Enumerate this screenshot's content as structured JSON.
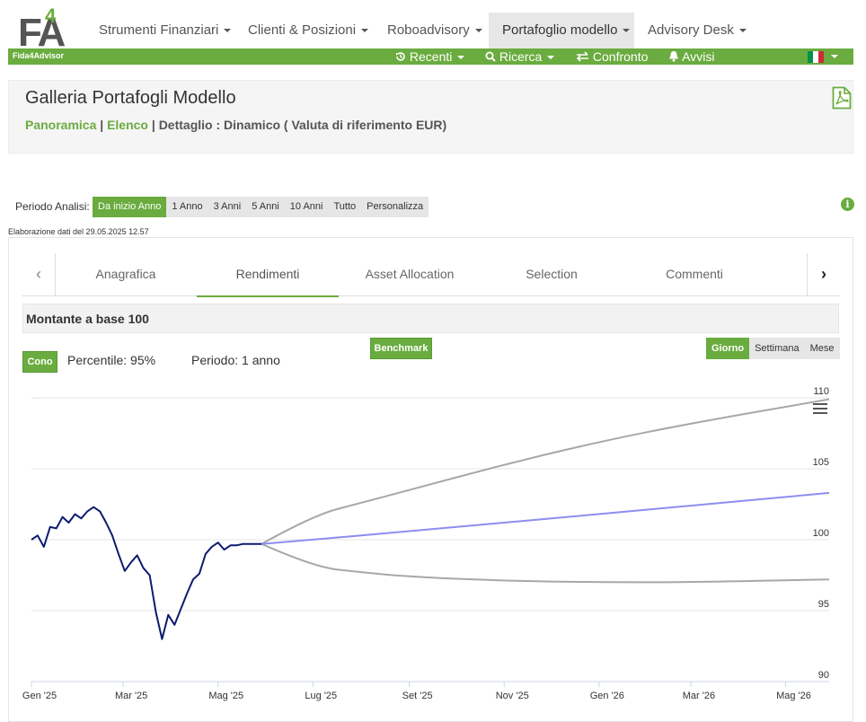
{
  "brand": {
    "logo_text": "F4A",
    "tagline": "Fida4Advisor"
  },
  "nav": {
    "items": [
      {
        "label": "Strumenti Finanziari"
      },
      {
        "label": "Clienti & Posizioni"
      },
      {
        "label": "Roboadvisory"
      },
      {
        "label": "Portafoglio modello"
      },
      {
        "label": "Advisory Desk"
      }
    ]
  },
  "subnav": {
    "recenti": "Recenti",
    "ricerca": "Ricerca",
    "confronto": "Confronto",
    "avvisi": "Avvisi"
  },
  "header": {
    "title": "Galleria Portafogli Modello",
    "crumb_panoramica": "Panoramica",
    "crumb_elenco": "Elenco",
    "crumb_detail": "Dettaglio : Dinamico ( Valuta di riferimento EUR)"
  },
  "period": {
    "label": "Periodo Analisi:",
    "options": [
      "Da inizio Anno",
      "1 Anno",
      "3 Anni",
      "5 Anni",
      "10 Anni",
      "Tutto",
      "Personalizza"
    ],
    "selected": "Da inizio Anno"
  },
  "elaboration": "Elaborazione dati del 29.05.2025 12.57",
  "tabs": [
    "Anagrafica",
    "Rendimenti",
    "Asset Allocation",
    "Selection",
    "Commenti"
  ],
  "active_tab": "Rendimenti",
  "section_title": "Montante a base 100",
  "controls": {
    "cono": "Cono",
    "percentile_label": "Percentile:",
    "percentile_value": "95%",
    "periodo_label": "Periodo:",
    "periodo_value": "1 anno",
    "benchmark": "Benchmark",
    "granularity": [
      "Giorno",
      "Settimana",
      "Mese"
    ],
    "granularity_selected": "Giorno"
  },
  "colors": {
    "brand_green": "#6aac3f",
    "historic_line": "#0d1b6e",
    "median_line": "#8d8df0",
    "cone_line": "#a8a8a8"
  },
  "chart_data": {
    "type": "line",
    "title": "",
    "ylim": [
      90,
      110
    ],
    "yticks": [
      90,
      95,
      100,
      105,
      110
    ],
    "x_ticks": [
      "Gen '25",
      "Mar '25",
      "Mag '25",
      "Lug '25",
      "Set '25",
      "Nov '25",
      "Gen '26",
      "Mar '26",
      "Mag '26"
    ],
    "series": [
      {
        "role": "historic",
        "x": [
          "2025-01-01",
          "2025-01-05",
          "2025-01-09",
          "2025-01-13",
          "2025-01-17",
          "2025-01-21",
          "2025-01-25",
          "2025-01-29",
          "2025-02-02",
          "2025-02-06",
          "2025-02-10",
          "2025-02-14",
          "2025-02-18",
          "2025-02-22",
          "2025-02-26",
          "2025-03-02",
          "2025-03-06",
          "2025-03-10",
          "2025-03-14",
          "2025-03-18",
          "2025-03-22",
          "2025-03-26",
          "2025-03-30",
          "2025-04-03",
          "2025-04-07",
          "2025-04-11",
          "2025-04-15",
          "2025-04-19",
          "2025-04-23",
          "2025-04-27",
          "2025-05-01",
          "2025-05-05",
          "2025-05-09",
          "2025-05-13",
          "2025-05-17",
          "2025-05-21",
          "2025-05-25",
          "2025-05-29"
        ],
        "values": [
          100.0,
          100.3,
          99.5,
          100.9,
          100.8,
          101.6,
          101.2,
          101.8,
          101.5,
          102.0,
          102.3,
          102.0,
          101.2,
          100.3,
          99.0,
          97.8,
          98.4,
          98.9,
          98.0,
          97.5,
          94.9,
          93.0,
          94.7,
          94.0,
          95.1,
          96.2,
          97.2,
          97.6,
          99.0,
          99.5,
          99.8,
          99.3,
          99.6,
          99.6,
          99.7,
          99.7,
          99.7,
          99.7
        ]
      },
      {
        "role": "median",
        "x": [
          "2025-05-29",
          "2025-07-01",
          "2025-09-01",
          "2025-11-01",
          "2026-01-01",
          "2026-03-01",
          "2026-05-29"
        ],
        "values": [
          99.7,
          100.0,
          100.6,
          101.2,
          101.8,
          102.4,
          103.3
        ]
      },
      {
        "role": "upper",
        "x": [
          "2025-05-29",
          "2025-07-01",
          "2025-08-01",
          "2025-09-01",
          "2025-11-01",
          "2026-01-01",
          "2026-03-01",
          "2026-05-29"
        ],
        "values": [
          99.7,
          101.7,
          102.6,
          103.5,
          105.3,
          106.9,
          108.2,
          109.9
        ]
      },
      {
        "role": "lower",
        "x": [
          "2025-05-29",
          "2025-07-01",
          "2025-08-01",
          "2025-09-01",
          "2025-11-01",
          "2026-01-01",
          "2026-03-01",
          "2026-05-29"
        ],
        "values": [
          99.7,
          98.1,
          97.7,
          97.4,
          97.1,
          97.0,
          97.0,
          97.2
        ]
      }
    ]
  }
}
